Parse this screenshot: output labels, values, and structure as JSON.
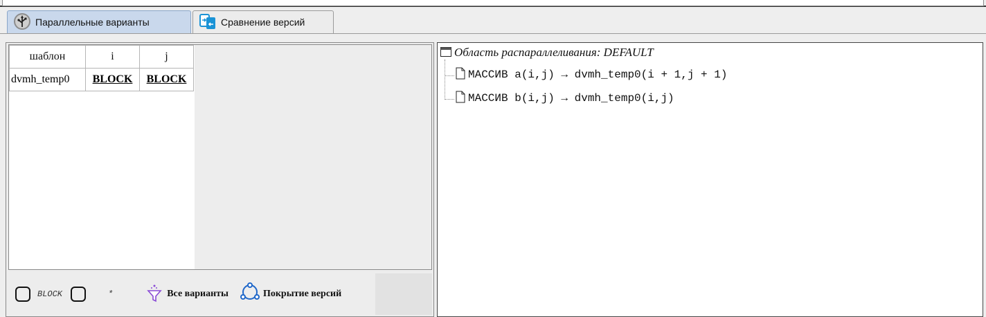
{
  "tabs": [
    {
      "label": "Параллельные варианты",
      "icon": "usb-branch-icon",
      "active": true
    },
    {
      "label": "Сравнение версий",
      "icon": "compare-versions-icon",
      "active": false
    }
  ],
  "variants_table": {
    "headers": [
      "шаблон",
      "i",
      "j"
    ],
    "rows": [
      {
        "template": "dvmh_temp0",
        "i": "BLOCK",
        "j": "BLOCK"
      }
    ]
  },
  "toolbar": {
    "checkbox1_label": "BLOCK",
    "checkbox2_label": "*",
    "all_variants_label": "Все варианты",
    "version_coverage_label": "Покрытие версий"
  },
  "tree": {
    "root_label": "Область распараллеливания: DEFAULT",
    "nodes": [
      {
        "label": "МАССИВ a(i,j) → dvmh_temp0(i + 1,j + 1)"
      },
      {
        "label": "МАССИВ b(i,j) → dvmh_temp0(i,j)"
      }
    ]
  },
  "colors": {
    "link": "#0000ee",
    "active_tab": "#c9d8ec"
  }
}
